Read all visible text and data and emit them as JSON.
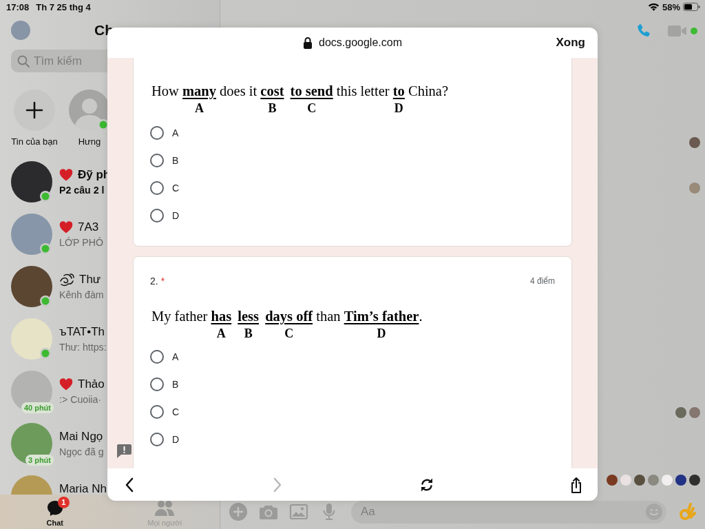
{
  "status_bar": {
    "time": "17:08",
    "date": "Th 7 25 thg 4",
    "battery": "58%"
  },
  "sidebar": {
    "title": "Ch",
    "search": {
      "placeholder": "Tìm kiếm"
    },
    "stories": [
      {
        "kind": "add",
        "label": "Tin của bạn",
        "online": false
      },
      {
        "kind": "person",
        "label": "Hưng",
        "online": true
      }
    ],
    "chats": [
      {
        "name": [
          {
            "kind": "heart"
          },
          {
            "kind": "text",
            "text": "Đỹ ph"
          }
        ],
        "preview": "P2 câu 2 l",
        "unread": true,
        "online": true
      },
      {
        "name": [
          {
            "kind": "heart"
          },
          {
            "kind": "text",
            "text": "7A3"
          }
        ],
        "preview": "LỚP PHÓ",
        "unread": false,
        "online": true
      },
      {
        "name": [
          {
            "kind": "swirl"
          },
          {
            "kind": "text",
            "text": "Thư"
          }
        ],
        "preview": "Kênh đàm",
        "unread": false,
        "online": true
      },
      {
        "name": [
          {
            "kind": "text",
            "text": "ъTAT•Th"
          }
        ],
        "preview": "Thư: https:",
        "unread": false,
        "online": true
      },
      {
        "name": [
          {
            "kind": "heart"
          },
          {
            "kind": "text",
            "text": "Thảo"
          }
        ],
        "preview": ":> Cuoiia·",
        "unread": false,
        "online": false,
        "active_ago": "40 phút"
      },
      {
        "name": [
          {
            "kind": "text",
            "text": "Mai Ngọ"
          }
        ],
        "preview": "Ngọc đã g",
        "unread": false,
        "online": false,
        "active_ago": "3 phút"
      },
      {
        "name": [
          {
            "kind": "text",
            "text": "Maria Nh"
          }
        ],
        "unread": false,
        "online": false
      }
    ],
    "tabs": [
      {
        "kind": "chat",
        "label": "Chat",
        "selected": true,
        "badge": "1"
      },
      {
        "kind": "people",
        "label": "Mọi người",
        "selected": false
      }
    ]
  },
  "conversation": {
    "composer": {
      "placeholder": "Aa"
    }
  },
  "browser_sheet": {
    "url": "docs.google.com",
    "done_button": "Xong",
    "questions": [
      {
        "sentence": [
          {
            "text": "How "
          },
          {
            "text": "many",
            "letter": "A"
          },
          {
            "text": " does it "
          },
          {
            "text": "cost",
            "letter": "B"
          },
          {
            "text": "to send",
            "letter": "C"
          },
          {
            "text": " this letter "
          },
          {
            "text": "to",
            "letter": "D"
          },
          {
            "text": " China?"
          }
        ],
        "options": [
          {
            "label": "A",
            "selected": false
          },
          {
            "label": "B",
            "selected": false
          },
          {
            "label": "C",
            "selected": false
          },
          {
            "label": "D",
            "selected": false
          }
        ]
      },
      {
        "number": "2.",
        "required_mark": "*",
        "points": "4 điểm",
        "sentence": [
          {
            "text": "My father "
          },
          {
            "text": "has",
            "letter": "A"
          },
          {
            "text": "less",
            "letter": "B"
          },
          {
            "text": "days off",
            "letter": "C"
          },
          {
            "text": " than "
          },
          {
            "text": "Tim’s father",
            "letter": "D"
          },
          {
            "text": "."
          }
        ],
        "options": [
          {
            "label": "A",
            "selected": false
          },
          {
            "label": "B",
            "selected": false
          },
          {
            "label": "C",
            "selected": false
          },
          {
            "label": "D",
            "selected": false
          }
        ]
      }
    ],
    "toolbar": [
      {
        "kind": "back",
        "disabled": false
      },
      {
        "kind": "forward",
        "disabled": true
      },
      {
        "kind": "reload",
        "disabled": false
      },
      {
        "kind": "share",
        "disabled": false
      }
    ]
  }
}
